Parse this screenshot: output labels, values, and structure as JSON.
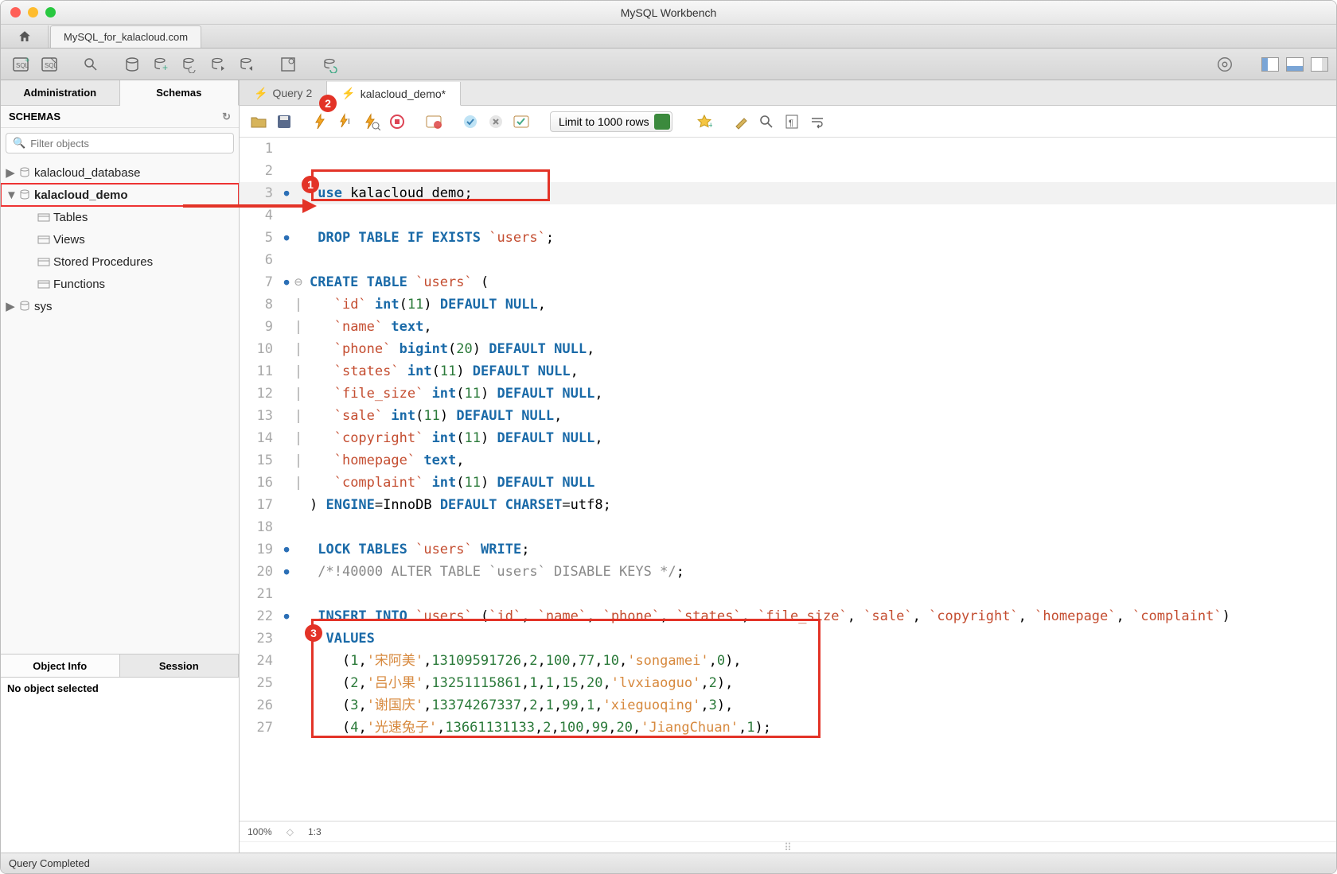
{
  "window": {
    "title": "MySQL Workbench"
  },
  "connection_tab": "MySQL_for_kalacloud.com",
  "sidebar": {
    "tabs": [
      "Administration",
      "Schemas"
    ],
    "active_tab": "Schemas",
    "header": "SCHEMAS",
    "filter_placeholder": "Filter objects",
    "tree": [
      {
        "label": "kalacloud_database",
        "level": 1
      },
      {
        "label": "kalacloud_demo",
        "level": 1,
        "expanded": true,
        "selected": true
      },
      {
        "label": "Tables",
        "level": 2
      },
      {
        "label": "Views",
        "level": 2
      },
      {
        "label": "Stored Procedures",
        "level": 2
      },
      {
        "label": "Functions",
        "level": 2
      },
      {
        "label": "sys",
        "level": 1
      }
    ],
    "object_info_tabs": [
      "Object Info",
      "Session"
    ],
    "object_info_active": "Object Info",
    "object_info_text": "No object selected"
  },
  "editor": {
    "tabs": [
      {
        "label": "Query 2",
        "active": false
      },
      {
        "label": "kalacloud_demo*",
        "active": true
      }
    ],
    "limit_label": "Limit to 1000 rows",
    "zoom": "100%",
    "cursor": "1:3",
    "lines": [
      {
        "n": 1,
        "bp": false,
        "fold": "",
        "html": ""
      },
      {
        "n": 2,
        "bp": false,
        "fold": "",
        "html": ""
      },
      {
        "n": 3,
        "bp": true,
        "fold": "",
        "hl": true,
        "html": " <span class='kw'>use</span> kalacloud_demo;"
      },
      {
        "n": 4,
        "bp": false,
        "fold": "",
        "html": ""
      },
      {
        "n": 5,
        "bp": true,
        "fold": "",
        "html": " <span class='kw'>DROP TABLE IF EXISTS</span> <span class='bt'>`users`</span>;"
      },
      {
        "n": 6,
        "bp": false,
        "fold": "",
        "html": ""
      },
      {
        "n": 7,
        "bp": true,
        "fold": "⊖",
        "html": "<span class='kw'>CREATE TABLE</span> <span class='bt'>`users`</span> ("
      },
      {
        "n": 8,
        "bp": false,
        "fold": "|",
        "html": "   <span class='bt'>`id`</span> <span class='kw'>int</span>(<span class='num'>11</span>) <span class='kw'>DEFAULT NULL</span>,"
      },
      {
        "n": 9,
        "bp": false,
        "fold": "|",
        "html": "   <span class='bt'>`name`</span> <span class='kw'>text</span>,"
      },
      {
        "n": 10,
        "bp": false,
        "fold": "|",
        "html": "   <span class='bt'>`phone`</span> <span class='kw'>bigint</span>(<span class='num'>20</span>) <span class='kw'>DEFAULT NULL</span>,"
      },
      {
        "n": 11,
        "bp": false,
        "fold": "|",
        "html": "   <span class='bt'>`states`</span> <span class='kw'>int</span>(<span class='num'>11</span>) <span class='kw'>DEFAULT NULL</span>,"
      },
      {
        "n": 12,
        "bp": false,
        "fold": "|",
        "html": "   <span class='bt'>`file_size`</span> <span class='kw'>int</span>(<span class='num'>11</span>) <span class='kw'>DEFAULT NULL</span>,"
      },
      {
        "n": 13,
        "bp": false,
        "fold": "|",
        "html": "   <span class='bt'>`sale`</span> <span class='kw'>int</span>(<span class='num'>11</span>) <span class='kw'>DEFAULT NULL</span>,"
      },
      {
        "n": 14,
        "bp": false,
        "fold": "|",
        "html": "   <span class='bt'>`copyright`</span> <span class='kw'>int</span>(<span class='num'>11</span>) <span class='kw'>DEFAULT NULL</span>,"
      },
      {
        "n": 15,
        "bp": false,
        "fold": "|",
        "html": "   <span class='bt'>`homepage`</span> <span class='kw'>text</span>,"
      },
      {
        "n": 16,
        "bp": false,
        "fold": "|",
        "html": "   <span class='bt'>`complaint`</span> <span class='kw'>int</span>(<span class='num'>11</span>) <span class='kw'>DEFAULT NULL</span>"
      },
      {
        "n": 17,
        "bp": false,
        "fold": "",
        "html": ") <span class='kw'>ENGINE</span><span class='eq'>=</span>InnoDB <span class='kw'>DEFAULT</span> <span class='kw'>CHARSET</span><span class='eq'>=</span>utf8;"
      },
      {
        "n": 18,
        "bp": false,
        "fold": "",
        "html": ""
      },
      {
        "n": 19,
        "bp": true,
        "fold": "",
        "html": " <span class='kw'>LOCK TABLES</span> <span class='bt'>`users`</span> <span class='kw'>WRITE</span>;"
      },
      {
        "n": 20,
        "bp": true,
        "fold": "",
        "html": " <span class='cmt'>/*!40000 ALTER TABLE `users` DISABLE KEYS */</span>;"
      },
      {
        "n": 21,
        "bp": false,
        "fold": "",
        "html": ""
      },
      {
        "n": 22,
        "bp": true,
        "fold": "",
        "html": " <span class='kw'>INSERT INTO</span> <span class='bt'>`users`</span> (<span class='bt'>`id`</span>, <span class='bt'>`name`</span>, <span class='bt'>`phone`</span>, <span class='bt'>`states`</span>, <span class='bt'>`file_size`</span>, <span class='bt'>`sale`</span>, <span class='bt'>`copyright`</span>, <span class='bt'>`homepage`</span>, <span class='bt'>`complaint`</span>)"
      },
      {
        "n": 23,
        "bp": false,
        "fold": "",
        "html": "  <span class='kw'>VALUES</span>"
      },
      {
        "n": 24,
        "bp": false,
        "fold": "",
        "html": "    (<span class='num'>1</span>,<span class='str'>'宋阿美'</span>,<span class='num'>13109591726</span>,<span class='num'>2</span>,<span class='num'>100</span>,<span class='num'>77</span>,<span class='num'>10</span>,<span class='str'>'songamei'</span>,<span class='num'>0</span>),"
      },
      {
        "n": 25,
        "bp": false,
        "fold": "",
        "html": "    (<span class='num'>2</span>,<span class='str'>'吕小果'</span>,<span class='num'>13251115861</span>,<span class='num'>1</span>,<span class='num'>1</span>,<span class='num'>15</span>,<span class='num'>20</span>,<span class='str'>'lvxiaoguo'</span>,<span class='num'>2</span>),"
      },
      {
        "n": 26,
        "bp": false,
        "fold": "",
        "html": "    (<span class='num'>3</span>,<span class='str'>'谢国庆'</span>,<span class='num'>13374267337</span>,<span class='num'>2</span>,<span class='num'>1</span>,<span class='num'>99</span>,<span class='num'>1</span>,<span class='str'>'xieguoqing'</span>,<span class='num'>3</span>),"
      },
      {
        "n": 27,
        "bp": false,
        "fold": "",
        "html": "    (<span class='num'>4</span>,<span class='str'>'光速兔子'</span>,<span class='num'>13661131133</span>,<span class='num'>2</span>,<span class='num'>100</span>,<span class='num'>99</span>,<span class='num'>20</span>,<span class='str'>'JiangChuan'</span>,<span class='num'>1</span>);"
      }
    ]
  },
  "statusbar": {
    "text": "Query Completed"
  },
  "callouts": {
    "c1": "1",
    "c2": "2",
    "c3": "3"
  }
}
